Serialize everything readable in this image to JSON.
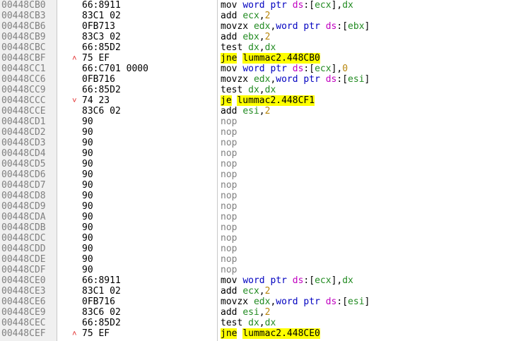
{
  "rows": [
    {
      "addr": "00448CB0",
      "arrow": "",
      "bytes": "66:8911",
      "tokens": [
        [
          "mn",
          "mov "
        ],
        [
          "sz",
          "word ptr "
        ],
        [
          "seg",
          "ds"
        ],
        [
          "p",
          ":["
        ],
        [
          "reg",
          "ecx"
        ],
        [
          "p",
          "],"
        ],
        [
          "reg",
          "dx"
        ]
      ]
    },
    {
      "addr": "00448CB3",
      "arrow": "",
      "bytes": "83C1 02",
      "tokens": [
        [
          "mn",
          "add "
        ],
        [
          "reg",
          "ecx"
        ],
        [
          "p",
          ","
        ],
        [
          "num",
          "2"
        ]
      ]
    },
    {
      "addr": "00448CB6",
      "arrow": "",
      "bytes": "0FB713",
      "tokens": [
        [
          "mn",
          "movzx "
        ],
        [
          "reg",
          "edx"
        ],
        [
          "p",
          ","
        ],
        [
          "sz",
          "word ptr "
        ],
        [
          "seg",
          "ds"
        ],
        [
          "p",
          ":["
        ],
        [
          "reg",
          "ebx"
        ],
        [
          "p",
          "]"
        ]
      ]
    },
    {
      "addr": "00448CB9",
      "arrow": "",
      "bytes": "83C3 02",
      "tokens": [
        [
          "mn",
          "add "
        ],
        [
          "reg",
          "ebx"
        ],
        [
          "p",
          ","
        ],
        [
          "num",
          "2"
        ]
      ]
    },
    {
      "addr": "00448CBC",
      "arrow": "",
      "bytes": "66:85D2",
      "tokens": [
        [
          "mn",
          "test "
        ],
        [
          "reg",
          "dx"
        ],
        [
          "p",
          ","
        ],
        [
          "reg",
          "dx"
        ]
      ]
    },
    {
      "addr": "00448CBF",
      "arrow": "^",
      "bytes": "75 EF",
      "tokens": [
        [
          "jump",
          "jne"
        ],
        [
          "mn",
          " "
        ],
        [
          "jump",
          "lummac2.448CB0"
        ]
      ]
    },
    {
      "addr": "00448CC1",
      "arrow": "",
      "bytes": "66:C701 0000",
      "tokens": [
        [
          "mn",
          "mov "
        ],
        [
          "sz",
          "word ptr "
        ],
        [
          "seg",
          "ds"
        ],
        [
          "p",
          ":["
        ],
        [
          "reg",
          "ecx"
        ],
        [
          "p",
          "],"
        ],
        [
          "num",
          "0"
        ]
      ]
    },
    {
      "addr": "00448CC6",
      "arrow": "",
      "bytes": "0FB716",
      "tokens": [
        [
          "mn",
          "movzx "
        ],
        [
          "reg",
          "edx"
        ],
        [
          "p",
          ","
        ],
        [
          "sz",
          "word ptr "
        ],
        [
          "seg",
          "ds"
        ],
        [
          "p",
          ":["
        ],
        [
          "reg",
          "esi"
        ],
        [
          "p",
          "]"
        ]
      ]
    },
    {
      "addr": "00448CC9",
      "arrow": "",
      "bytes": "66:85D2",
      "tokens": [
        [
          "mn",
          "test "
        ],
        [
          "reg",
          "dx"
        ],
        [
          "p",
          ","
        ],
        [
          "reg",
          "dx"
        ]
      ]
    },
    {
      "addr": "00448CCC",
      "arrow": "v",
      "bytes": "74 23",
      "tokens": [
        [
          "jump",
          "je"
        ],
        [
          "mn",
          " "
        ],
        [
          "jump",
          "lummac2.448CF1"
        ]
      ]
    },
    {
      "addr": "00448CCE",
      "arrow": "",
      "bytes": "83C6 02",
      "tokens": [
        [
          "mn",
          "add "
        ],
        [
          "reg",
          "esi"
        ],
        [
          "p",
          ","
        ],
        [
          "num",
          "2"
        ]
      ]
    },
    {
      "addr": "00448CD1",
      "arrow": "",
      "bytes": "90",
      "tokens": [
        [
          "nop",
          "nop"
        ]
      ]
    },
    {
      "addr": "00448CD2",
      "arrow": "",
      "bytes": "90",
      "tokens": [
        [
          "nop",
          "nop"
        ]
      ]
    },
    {
      "addr": "00448CD3",
      "arrow": "",
      "bytes": "90",
      "tokens": [
        [
          "nop",
          "nop"
        ]
      ]
    },
    {
      "addr": "00448CD4",
      "arrow": "",
      "bytes": "90",
      "tokens": [
        [
          "nop",
          "nop"
        ]
      ]
    },
    {
      "addr": "00448CD5",
      "arrow": "",
      "bytes": "90",
      "tokens": [
        [
          "nop",
          "nop"
        ]
      ]
    },
    {
      "addr": "00448CD6",
      "arrow": "",
      "bytes": "90",
      "tokens": [
        [
          "nop",
          "nop"
        ]
      ]
    },
    {
      "addr": "00448CD7",
      "arrow": "",
      "bytes": "90",
      "tokens": [
        [
          "nop",
          "nop"
        ]
      ]
    },
    {
      "addr": "00448CD8",
      "arrow": "",
      "bytes": "90",
      "tokens": [
        [
          "nop",
          "nop"
        ]
      ]
    },
    {
      "addr": "00448CD9",
      "arrow": "",
      "bytes": "90",
      "tokens": [
        [
          "nop",
          "nop"
        ]
      ]
    },
    {
      "addr": "00448CDA",
      "arrow": "",
      "bytes": "90",
      "tokens": [
        [
          "nop",
          "nop"
        ]
      ]
    },
    {
      "addr": "00448CDB",
      "arrow": "",
      "bytes": "90",
      "tokens": [
        [
          "nop",
          "nop"
        ]
      ]
    },
    {
      "addr": "00448CDC",
      "arrow": "",
      "bytes": "90",
      "tokens": [
        [
          "nop",
          "nop"
        ]
      ]
    },
    {
      "addr": "00448CDD",
      "arrow": "",
      "bytes": "90",
      "tokens": [
        [
          "nop",
          "nop"
        ]
      ]
    },
    {
      "addr": "00448CDE",
      "arrow": "",
      "bytes": "90",
      "tokens": [
        [
          "nop",
          "nop"
        ]
      ]
    },
    {
      "addr": "00448CDF",
      "arrow": "",
      "bytes": "90",
      "tokens": [
        [
          "nop",
          "nop"
        ]
      ]
    },
    {
      "addr": "00448CE0",
      "arrow": "",
      "bytes": "66:8911",
      "tokens": [
        [
          "mn",
          "mov "
        ],
        [
          "sz",
          "word ptr "
        ],
        [
          "seg",
          "ds"
        ],
        [
          "p",
          ":["
        ],
        [
          "reg",
          "ecx"
        ],
        [
          "p",
          "],"
        ],
        [
          "reg",
          "dx"
        ]
      ]
    },
    {
      "addr": "00448CE3",
      "arrow": "",
      "bytes": "83C1 02",
      "tokens": [
        [
          "mn",
          "add "
        ],
        [
          "reg",
          "ecx"
        ],
        [
          "p",
          ","
        ],
        [
          "num",
          "2"
        ]
      ]
    },
    {
      "addr": "00448CE6",
      "arrow": "",
      "bytes": "0FB716",
      "tokens": [
        [
          "mn",
          "movzx "
        ],
        [
          "reg",
          "edx"
        ],
        [
          "p",
          ","
        ],
        [
          "sz",
          "word ptr "
        ],
        [
          "seg",
          "ds"
        ],
        [
          "p",
          ":["
        ],
        [
          "reg",
          "esi"
        ],
        [
          "p",
          "]"
        ]
      ]
    },
    {
      "addr": "00448CE9",
      "arrow": "",
      "bytes": "83C6 02",
      "tokens": [
        [
          "mn",
          "add "
        ],
        [
          "reg",
          "esi"
        ],
        [
          "p",
          ","
        ],
        [
          "num",
          "2"
        ]
      ]
    },
    {
      "addr": "00448CEC",
      "arrow": "",
      "bytes": "66:85D2",
      "tokens": [
        [
          "mn",
          "test "
        ],
        [
          "reg",
          "dx"
        ],
        [
          "p",
          ","
        ],
        [
          "reg",
          "dx"
        ]
      ]
    },
    {
      "addr": "00448CEF",
      "arrow": "^",
      "bytes": "75 EF",
      "tokens": [
        [
          "jump",
          "jne"
        ],
        [
          "mn",
          " "
        ],
        [
          "jump",
          "lummac2.448CE0"
        ]
      ]
    }
  ]
}
